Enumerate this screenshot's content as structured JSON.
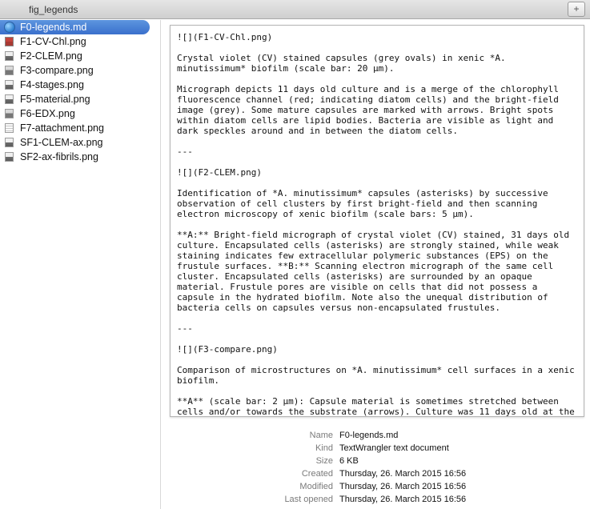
{
  "window": {
    "title": "fig_legends",
    "add_button": "+"
  },
  "files": [
    {
      "name": "F0-legends.md",
      "icon": "markdown-file-icon",
      "selected": true
    },
    {
      "name": "F1-CV-Chl.png",
      "icon": "image-file-icon"
    },
    {
      "name": "F2-CLEM.png",
      "icon": "image-file-icon"
    },
    {
      "name": "F3-compare.png",
      "icon": "image-file-icon"
    },
    {
      "name": "F4-stages.png",
      "icon": "image-file-icon"
    },
    {
      "name": "F5-material.png",
      "icon": "image-file-icon"
    },
    {
      "name": "F6-EDX.png",
      "icon": "image-file-icon"
    },
    {
      "name": "F7-attachment.png",
      "icon": "document-file-icon"
    },
    {
      "name": "SF1-CLEM-ax.png",
      "icon": "image-file-icon"
    },
    {
      "name": "SF2-ax-fibrils.png",
      "icon": "image-file-icon"
    }
  ],
  "preview": {
    "text": "![](F1-CV-Chl.png)\n\nCrystal violet (CV) stained capsules (grey ovals) in xenic *A.\nminutissimum* biofilm (scale bar: 20 µm).\n\nMicrograph depicts 11 days old culture and is a merge of the chlorophyll\nfluorescence channel (red; indicating diatom cells) and the bright-field\nimage (grey). Some mature capsules are marked with arrows. Bright spots\nwithin diatom cells are lipid bodies. Bacteria are visible as light and\ndark speckles around and in between the diatom cells.\n\n---\n\n![](F2-CLEM.png)\n\nIdentification of *A. minutissimum* capsules (asterisks) by successive\nobservation of cell clusters by first bright-field and then scanning\nelectron microscopy of xenic biofilm (scale bars: 5 µm).\n\n**A:** Bright-field micrograph of crystal violet (CV) stained, 31 days old\nculture. Encapsulated cells (asterisks) are strongly stained, while weak\nstaining indicates few extracellular polymeric substances (EPS) on the\nfrustule surfaces. **B:** Scanning electron micrograph of the same cell\ncluster. Encapsulated cells (asterisks) are surrounded by an opaque\nmaterial. Frustule pores are visible on cells that did not possess a\ncapsule in the hydrated biofilm. Note also the unequal distribution of\nbacteria cells on capsules versus non-encapsulated frustules.\n\n---\n\n![](F3-compare.png)\n\nComparison of microstructures on *A. minutissimum* cell surfaces in a xenic\nbiofilm.\n\n**A** (scale bar: 2 µm): Capsule material is sometimes stretched between\ncells and/or towards the substrate (arrows). Culture was 11 days old at the"
  },
  "info": [
    {
      "label": "Name",
      "value": "F0-legends.md"
    },
    {
      "label": "Kind",
      "value": "TextWrangler text document"
    },
    {
      "label": "Size",
      "value": "6 KB"
    },
    {
      "label": "Created",
      "value": "Thursday, 26. March 2015 16:56"
    },
    {
      "label": "Modified",
      "value": "Thursday, 26. March 2015 16:56"
    },
    {
      "label": "Last opened",
      "value": "Thursday, 26. March 2015 16:56"
    }
  ]
}
